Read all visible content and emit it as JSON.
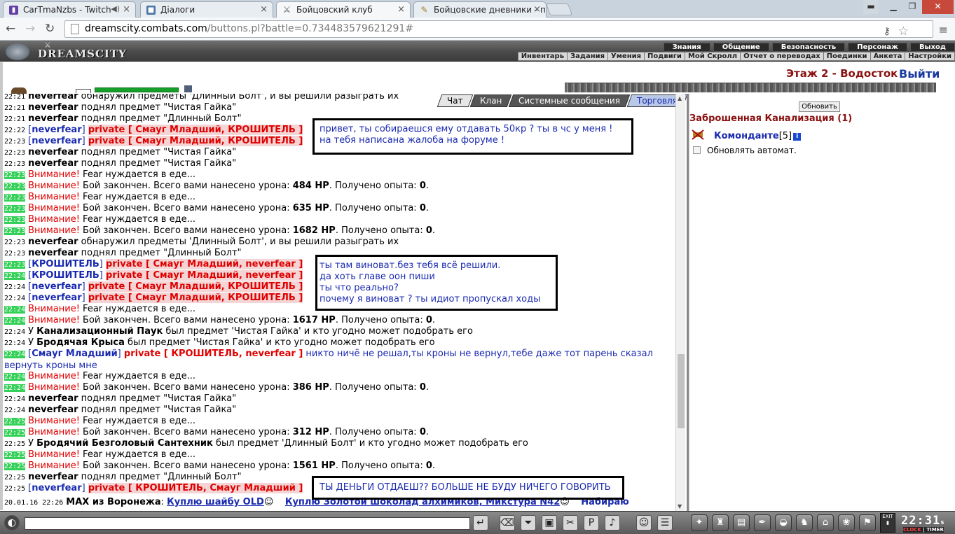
{
  "browser": {
    "tabs": [
      {
        "title": "CarTmaNzbs - Twitch",
        "icon": "twitch-icon"
      },
      {
        "title": "Діалоги",
        "icon": "vk-icon"
      },
      {
        "title": "Бойцовский клуб",
        "icon": "swords-icon"
      },
      {
        "title": "Бойцовские дневники - п",
        "icon": "diary-icon"
      }
    ],
    "url_host": "dreamscity.combats.com",
    "url_path": "/buttons.pl?battle=0.734483579621291#"
  },
  "game": {
    "logo": "DREAMSCITY",
    "top_menu": [
      "Знания",
      "Общение",
      "Безопасность",
      "Персонаж",
      "Выход"
    ],
    "sub_menu": [
      "Инвентарь",
      "Задания",
      "Умения",
      "Подвиги",
      "Мой Скролл",
      "Отчет о переводах",
      "Поединки",
      "Анкета",
      "Настройки"
    ],
    "location": "Этаж 2 - Водосток",
    "exit_label": "Выйти"
  },
  "chat_tabs": [
    "Чат",
    "Клан",
    "Системные сообщения",
    "Торговля"
  ],
  "chat": {
    "l0": {
      "t": "22:21",
      "nick": "neverfear",
      "text": " обнаружил предметы 'Длинный Болт', и вы решили разыграть их"
    },
    "l1": {
      "t": "22:21",
      "nick": "neverfear",
      "text": " поднял предмет \"Чистая Гайка\""
    },
    "l2": {
      "t": "22:21",
      "nick": "neverfear",
      "text": " поднял предмет \"Длинный Болт\""
    },
    "l3": {
      "t": "22:22",
      "from": "neverfear",
      "priv": "private [ Смауг Младший, КРОШИТЕЛЬ ]"
    },
    "l4": {
      "t": "22:23",
      "from": "neverfear",
      "priv": "private [ Смауг Младший, КРОШИТЕЛЬ ]"
    },
    "l5": {
      "t": "22:23",
      "nick": "neverfear",
      "text": " поднял предмет \"Чистая Гайка\""
    },
    "l6": {
      "t": "22:23",
      "nick": "neverfear",
      "text": " поднял предмет \"Чистая Гайка\""
    },
    "l7": {
      "t": "22:23",
      "warn": "Внимание!",
      "text": " Fear нуждается в еде..."
    },
    "l8": {
      "t": "22:23",
      "warn": "Внимание!",
      "pre": " Бой закончен. Всего вами нанесено урона: ",
      "hp": "484 HP",
      "mid": ". Получено опыта: ",
      "exp": "0",
      "end": "."
    },
    "l9": {
      "t": "22:23",
      "warn": "Внимание!",
      "text": " Fear нуждается в еде..."
    },
    "l10": {
      "t": "22:23",
      "warn": "Внимание!",
      "pre": " Бой закончен. Всего вами нанесено урона: ",
      "hp": "635 HP",
      "mid": ". Получено опыта: ",
      "exp": "0",
      "end": "."
    },
    "l11": {
      "t": "22:23",
      "warn": "Внимание!",
      "text": " Fear нуждается в еде..."
    },
    "l12": {
      "t": "22:23",
      "warn": "Внимание!",
      "pre": " Бой закончен. Всего вами нанесено урона: ",
      "hp": "1682 HP",
      "mid": ". Получено опыта: ",
      "exp": "0",
      "end": "."
    },
    "l13": {
      "t": "22:23",
      "nick": "neverfear",
      "text": " обнаружил предметы 'Длинный Болт', и вы решили разыграть их"
    },
    "l14": {
      "t": "22:23",
      "nick": "neverfear",
      "text": " поднял предмет \"Длинный Болт\""
    },
    "l15": {
      "t": "22:23",
      "from": "КРОШИТЕЛЬ",
      "priv": "private [ Смауг Младший, neverfear ]"
    },
    "l16": {
      "t": "22:24",
      "from": "КРОШИТЕЛЬ",
      "priv": "private [ Смауг Младший, neverfear ]"
    },
    "l17": {
      "t": "22:24",
      "from": "neverfear",
      "priv": "private [ Смауг Младший, КРОШИТЕЛЬ ]"
    },
    "l18": {
      "t": "22:24",
      "from": "neverfear",
      "priv": "private [ Смауг Младший, КРОШИТЕЛЬ ]"
    },
    "l19": {
      "t": "22:24",
      "warn": "Внимание!",
      "text": " Fear нуждается в еде..."
    },
    "l20": {
      "t": "22:24",
      "warn": "Внимание!",
      "pre": " Бой закончен. Всего вами нанесено урона: ",
      "hp": "1617 HP",
      "mid": ". Получено опыта: ",
      "exp": "0",
      "end": "."
    },
    "l21": {
      "t": "22:24",
      "pre": "У ",
      "nick": "Канализационный Паук",
      "text": " был предмет 'Чистая Гайка' и кто угодно может подобрать его"
    },
    "l22": {
      "t": "22:24",
      "pre": "У ",
      "nick": "Бродячая Крыса",
      "text": " был предмет 'Чистая Гайка' и кто угодно может подобрать его"
    },
    "l23": {
      "t": "22:24",
      "from": "Смауг Младший",
      "priv": "private [ КРОШИТЕЛЬ, neverfear ]",
      "msg": " никто ничё не решал,ты кроны не вернул,тебе даже тот парень сказал вернуть кроны мне"
    },
    "l24": {
      "t": "22:24",
      "warn": "Внимание!",
      "text": " Fear нуждается в еде..."
    },
    "l25": {
      "t": "22:24",
      "warn": "Внимание!",
      "pre": " Бой закончен. Всего вами нанесено урона: ",
      "hp": "386 HP",
      "mid": ". Получено опыта: ",
      "exp": "0",
      "end": "."
    },
    "l26": {
      "t": "22:24",
      "nick": "neverfear",
      "text": " поднял предмет \"Чистая Гайка\""
    },
    "l27": {
      "t": "22:24",
      "nick": "neverfear",
      "text": " поднял предмет \"Чистая Гайка\""
    },
    "l28": {
      "t": "22:25",
      "warn": "Внимание!",
      "text": " Fear нуждается в еде..."
    },
    "l29": {
      "t": "22:25",
      "warn": "Внимание!",
      "pre": " Бой закончен. Всего вами нанесено урона: ",
      "hp": "312 HP",
      "mid": ". Получено опыта: ",
      "exp": "0",
      "end": "."
    },
    "l30": {
      "t": "22:25",
      "pre": "У ",
      "nick": "Бродячий Безголовый Сантехник",
      "text": " был предмет 'Длинный Болт' и кто угодно может подобрать его"
    },
    "l31": {
      "t": "22:25",
      "warn": "Внимание!",
      "text": " Fear нуждается в еде..."
    },
    "l32": {
      "t": "22:25",
      "warn": "Внимание!",
      "pre": " Бой закончен. Всего вами нанесено урона: ",
      "hp": "1561 HP",
      "mid": ". Получено опыта: ",
      "exp": "0",
      "end": "."
    },
    "l33": {
      "t": "22:25",
      "nick": "neverfear",
      "text": " поднял предмет \"Длинный Болт\""
    },
    "l34": {
      "t": "22:25",
      "from": "neverfear",
      "priv": "private [ КРОШИТЕЛЬ, Смауг Младший ]"
    },
    "l35": {
      "t": "20.01.16 22:26",
      "nick": "MAX из Воронежа",
      "colon": ": ",
      "trade1": "Куплю шайбу OLD",
      "trade2": "Куплю Золотой шоколад алхимиков, Микстура N42",
      "trade3": "Набираю"
    }
  },
  "highlights": {
    "h1": [
      "привет, ты собираешся ему отдавать 50кр ? ты в чс у меня !",
      "на тебя написана жалоба на форуме !"
    ],
    "h2": [
      "ты там виноват.без тебя всё решили.",
      "да хоть главе оон пиши",
      "ты что реально?",
      "почему я виноват ? ты идиот пропускал ходы"
    ],
    "h3": [
      "ТЫ ДЕНЬГИ ОТДАЕШ?? БОЛЬШЕ НЕ БУДУ НИЧЕГО ГОВОРИТЬ"
    ]
  },
  "right_panel": {
    "refresh_label": "Обновить",
    "room_title": "Заброшенная Канализация (1)",
    "player_name": "Комонданте",
    "player_level": "[5]",
    "player_info": "i",
    "auto_refresh_label": "Обновлять автомат."
  },
  "bottom": {
    "clock": "22:31",
    "clock_seconds": "s",
    "clock_label_left": "CLOCK",
    "clock_label_right": "TIMER",
    "exit_label": "EXIT"
  },
  "colors": {
    "accent_red": "#e00000",
    "link_blue": "#1a2ab0",
    "time_green": "#34d058",
    "location_red": "#8a1010"
  }
}
